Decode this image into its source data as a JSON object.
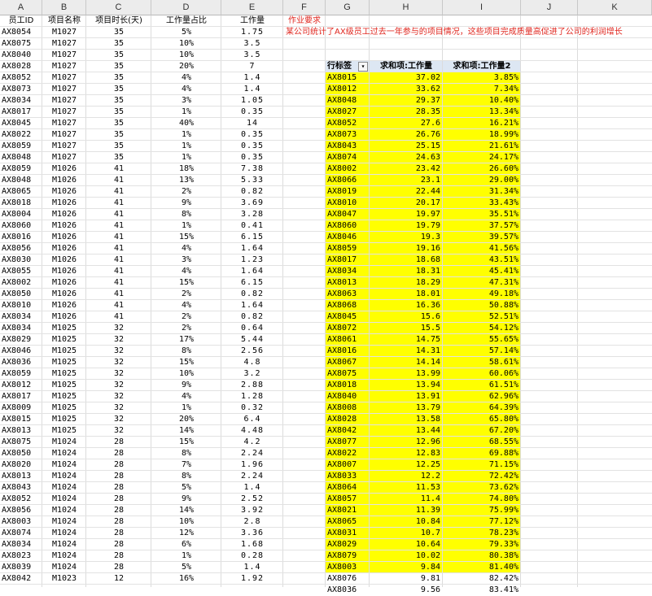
{
  "columns": [
    "A",
    "B",
    "C",
    "D",
    "E",
    "F",
    "G",
    "H",
    "I",
    "J",
    "K"
  ],
  "headers": [
    "员工ID",
    "项目名称",
    "项目时长(天)",
    "工作量占比",
    "工作量"
  ],
  "rows": [
    [
      "AX8054",
      "M1027",
      "35",
      "5%",
      "1.75"
    ],
    [
      "AX8075",
      "M1027",
      "35",
      "10%",
      "3.5"
    ],
    [
      "AX8040",
      "M1027",
      "35",
      "10%",
      "3.5"
    ],
    [
      "AX8028",
      "M1027",
      "35",
      "20%",
      "7"
    ],
    [
      "AX8052",
      "M1027",
      "35",
      "4%",
      "1.4"
    ],
    [
      "AX8073",
      "M1027",
      "35",
      "4%",
      "1.4"
    ],
    [
      "AX8034",
      "M1027",
      "35",
      "3%",
      "1.05"
    ],
    [
      "AX8017",
      "M1027",
      "35",
      "1%",
      "0.35"
    ],
    [
      "AX8045",
      "M1027",
      "35",
      "40%",
      "14"
    ],
    [
      "AX8022",
      "M1027",
      "35",
      "1%",
      "0.35"
    ],
    [
      "AX8059",
      "M1027",
      "35",
      "1%",
      "0.35"
    ],
    [
      "AX8048",
      "M1027",
      "35",
      "1%",
      "0.35"
    ],
    [
      "AX8059",
      "M1026",
      "41",
      "18%",
      "7.38"
    ],
    [
      "AX8048",
      "M1026",
      "41",
      "13%",
      "5.33"
    ],
    [
      "AX8065",
      "M1026",
      "41",
      "2%",
      "0.82"
    ],
    [
      "AX8018",
      "M1026",
      "41",
      "9%",
      "3.69"
    ],
    [
      "AX8004",
      "M1026",
      "41",
      "8%",
      "3.28"
    ],
    [
      "AX8060",
      "M1026",
      "41",
      "1%",
      "0.41"
    ],
    [
      "AX8016",
      "M1026",
      "41",
      "15%",
      "6.15"
    ],
    [
      "AX8056",
      "M1026",
      "41",
      "4%",
      "1.64"
    ],
    [
      "AX8030",
      "M1026",
      "41",
      "3%",
      "1.23"
    ],
    [
      "AX8055",
      "M1026",
      "41",
      "4%",
      "1.64"
    ],
    [
      "AX8002",
      "M1026",
      "41",
      "15%",
      "6.15"
    ],
    [
      "AX8050",
      "M1026",
      "41",
      "2%",
      "0.82"
    ],
    [
      "AX8010",
      "M1026",
      "41",
      "4%",
      "1.64"
    ],
    [
      "AX8034",
      "M1026",
      "41",
      "2%",
      "0.82"
    ],
    [
      "AX8034",
      "M1025",
      "32",
      "2%",
      "0.64"
    ],
    [
      "AX8029",
      "M1025",
      "32",
      "17%",
      "5.44"
    ],
    [
      "AX8046",
      "M1025",
      "32",
      "8%",
      "2.56"
    ],
    [
      "AX8036",
      "M1025",
      "32",
      "15%",
      "4.8"
    ],
    [
      "AX8059",
      "M1025",
      "32",
      "10%",
      "3.2"
    ],
    [
      "AX8012",
      "M1025",
      "32",
      "9%",
      "2.88"
    ],
    [
      "AX8017",
      "M1025",
      "32",
      "4%",
      "1.28"
    ],
    [
      "AX8009",
      "M1025",
      "32",
      "1%",
      "0.32"
    ],
    [
      "AX8015",
      "M1025",
      "32",
      "20%",
      "6.4"
    ],
    [
      "AX8013",
      "M1025",
      "32",
      "14%",
      "4.48"
    ],
    [
      "AX8075",
      "M1024",
      "28",
      "15%",
      "4.2"
    ],
    [
      "AX8050",
      "M1024",
      "28",
      "8%",
      "2.24"
    ],
    [
      "AX8020",
      "M1024",
      "28",
      "7%",
      "1.96"
    ],
    [
      "AX8013",
      "M1024",
      "28",
      "8%",
      "2.24"
    ],
    [
      "AX8043",
      "M1024",
      "28",
      "5%",
      "1.4"
    ],
    [
      "AX8052",
      "M1024",
      "28",
      "9%",
      "2.52"
    ],
    [
      "AX8056",
      "M1024",
      "28",
      "14%",
      "3.92"
    ],
    [
      "AX8003",
      "M1024",
      "28",
      "10%",
      "2.8"
    ],
    [
      "AX8074",
      "M1024",
      "28",
      "12%",
      "3.36"
    ],
    [
      "AX8034",
      "M1024",
      "28",
      "6%",
      "1.68"
    ],
    [
      "AX8023",
      "M1024",
      "28",
      "1%",
      "0.28"
    ],
    [
      "AX8039",
      "M1024",
      "28",
      "5%",
      "1.4"
    ],
    [
      "AX8042",
      "M1023",
      "12",
      "16%",
      "1.92"
    ]
  ],
  "task": {
    "title": "作业要求",
    "text": "某公司统计了AX级员工过去一年参与的项目情况，这些项目完成质量高促进了公司的利润增长"
  },
  "pivot": {
    "headers": [
      "行标签",
      "求和项:工作量",
      "求和项:工作量2"
    ],
    "filter_icon": "filter-dropdown-icon",
    "highlight_color": "#ffff00",
    "highlight_count": 44,
    "rows": [
      [
        "AX8015",
        "37.02",
        "3.85%"
      ],
      [
        "AX8012",
        "33.62",
        "7.34%"
      ],
      [
        "AX8048",
        "29.37",
        "10.40%"
      ],
      [
        "AX8027",
        "28.35",
        "13.34%"
      ],
      [
        "AX8052",
        "27.6",
        "16.21%"
      ],
      [
        "AX8073",
        "26.76",
        "18.99%"
      ],
      [
        "AX8043",
        "25.15",
        "21.61%"
      ],
      [
        "AX8074",
        "24.63",
        "24.17%"
      ],
      [
        "AX8002",
        "23.42",
        "26.60%"
      ],
      [
        "AX8066",
        "23.1",
        "29.00%"
      ],
      [
        "AX8019",
        "22.44",
        "31.34%"
      ],
      [
        "AX8010",
        "20.17",
        "33.43%"
      ],
      [
        "AX8047",
        "19.97",
        "35.51%"
      ],
      [
        "AX8060",
        "19.79",
        "37.57%"
      ],
      [
        "AX8046",
        "19.3",
        "39.57%"
      ],
      [
        "AX8059",
        "19.16",
        "41.56%"
      ],
      [
        "AX8017",
        "18.68",
        "43.51%"
      ],
      [
        "AX8034",
        "18.31",
        "45.41%"
      ],
      [
        "AX8013",
        "18.29",
        "47.31%"
      ],
      [
        "AX8063",
        "18.01",
        "49.18%"
      ],
      [
        "AX8068",
        "16.36",
        "50.88%"
      ],
      [
        "AX8045",
        "15.6",
        "52.51%"
      ],
      [
        "AX8072",
        "15.5",
        "54.12%"
      ],
      [
        "AX8061",
        "14.75",
        "55.65%"
      ],
      [
        "AX8016",
        "14.31",
        "57.14%"
      ],
      [
        "AX8067",
        "14.14",
        "58.61%"
      ],
      [
        "AX8075",
        "13.99",
        "60.06%"
      ],
      [
        "AX8018",
        "13.94",
        "61.51%"
      ],
      [
        "AX8040",
        "13.91",
        "62.96%"
      ],
      [
        "AX8008",
        "13.79",
        "64.39%"
      ],
      [
        "AX8028",
        "13.58",
        "65.80%"
      ],
      [
        "AX8042",
        "13.44",
        "67.20%"
      ],
      [
        "AX8077",
        "12.96",
        "68.55%"
      ],
      [
        "AX8022",
        "12.83",
        "69.88%"
      ],
      [
        "AX8007",
        "12.25",
        "71.15%"
      ],
      [
        "AX8033",
        "12.2",
        "72.42%"
      ],
      [
        "AX8064",
        "11.53",
        "73.62%"
      ],
      [
        "AX8057",
        "11.4",
        "74.80%"
      ],
      [
        "AX8021",
        "11.39",
        "75.99%"
      ],
      [
        "AX8065",
        "10.84",
        "77.12%"
      ],
      [
        "AX8031",
        "10.7",
        "78.23%"
      ],
      [
        "AX8029",
        "10.64",
        "79.33%"
      ],
      [
        "AX8079",
        "10.02",
        "80.38%"
      ],
      [
        "AX8003",
        "9.84",
        "81.40%"
      ],
      [
        "AX8076",
        "9.81",
        "82.42%"
      ],
      [
        "AX8036",
        "9.56",
        "83.41%"
      ]
    ]
  }
}
